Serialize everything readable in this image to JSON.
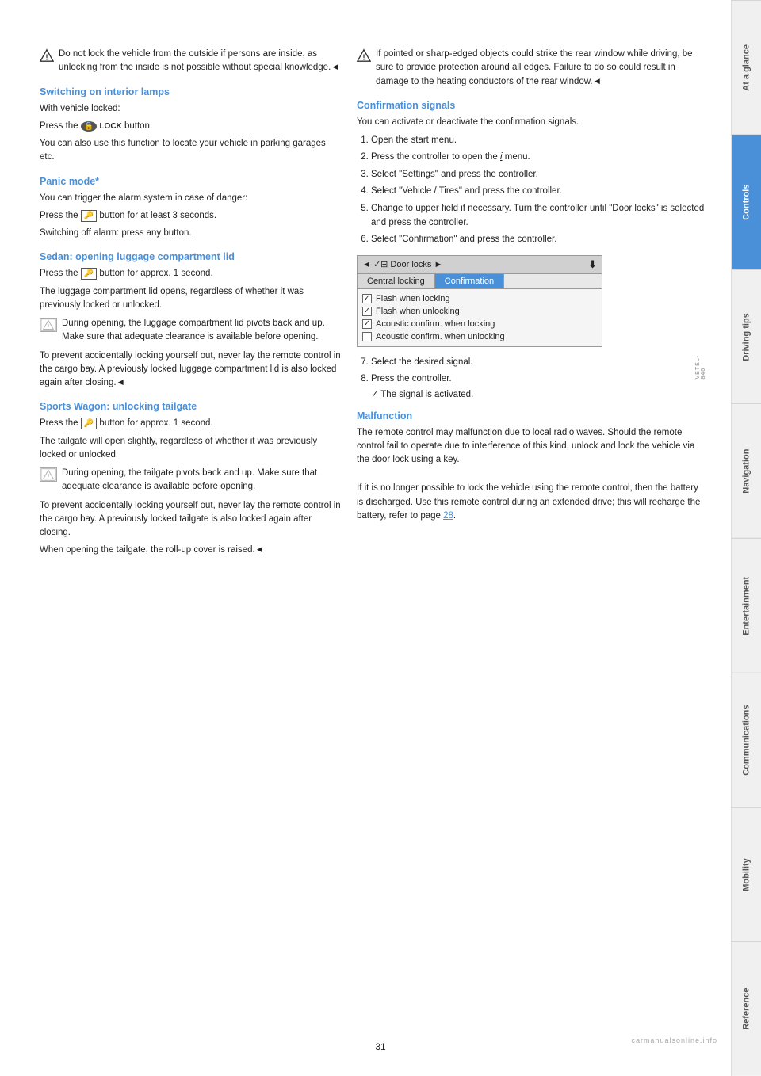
{
  "page": {
    "number": "31"
  },
  "sidebar": {
    "tabs": [
      {
        "label": "At a glance",
        "active": false
      },
      {
        "label": "Controls",
        "active": true
      },
      {
        "label": "Driving tips",
        "active": false
      },
      {
        "label": "Navigation",
        "active": false
      },
      {
        "label": "Entertainment",
        "active": false
      },
      {
        "label": "Communications",
        "active": false
      },
      {
        "label": "Mobility",
        "active": false
      },
      {
        "label": "Reference",
        "active": false
      }
    ]
  },
  "left_col": {
    "warning1": {
      "text": "Do not lock the vehicle from the outside if persons are inside, as unlocking from the inside is not possible without special knowledge.◄"
    },
    "switching_heading": "Switching on interior lamps",
    "switching_text": [
      "With vehicle locked:",
      "Press the 🔒 LOCK button.",
      "You can also use this function to locate your vehicle in parking garages etc."
    ],
    "panic_heading": "Panic mode*",
    "panic_text": [
      "You can trigger the alarm system in case of danger:",
      "Press the 🔑 button for at least 3 seconds.",
      "Switching off alarm: press any button."
    ],
    "sedan_heading": "Sedan: opening luggage compartment lid",
    "sedan_text1": "Press the 🔑 button for approx. 1 second.",
    "sedan_text2": "The luggage compartment lid opens, regardless of whether it was previously locked or unlocked.",
    "sedan_note": "During opening, the luggage compartment lid pivots back and up. Make sure that adequate clearance is available before opening.",
    "sedan_text3": "To prevent accidentally locking yourself out, never lay the remote control in the cargo bay. A previously locked luggage compartment lid is also locked again after closing.◄",
    "sports_heading": "Sports Wagon: unlocking tailgate",
    "sports_text1": "Press the 🔑 button for approx. 1 second.",
    "sports_text2": "The tailgate will open slightly, regardless of whether it was previously locked or unlocked.",
    "sports_note": "During opening, the tailgate pivots back and up. Make sure that adequate clearance is available before opening.",
    "sports_text3": "To prevent accidentally locking yourself out, never lay the remote control in the cargo bay. A previously locked tailgate is also locked again after closing.",
    "sports_text4": "When opening the tailgate, the roll-up cover is raised.◄"
  },
  "right_col": {
    "warning2": {
      "text": "If pointed or sharp-edged objects could strike the rear window while driving, be sure to provide protection around all edges. Failure to do so could result in damage to the heating conductors of the rear window.◄"
    },
    "confirmation_heading": "Confirmation signals",
    "confirmation_intro": "You can activate or deactivate the confirmation signals.",
    "steps": [
      "Open the start menu.",
      "Press the controller to open the i menu.",
      "Select \"Settings\" and press the controller.",
      "Select \"Vehicle / Tires\" and press the controller.",
      "Change to upper field if necessary. Turn the controller until \"Door locks\" is selected and press the controller.",
      "Select \"Confirmation\" and press the controller."
    ],
    "door_locks_ui": {
      "header_left": "◄ ✓⊟ Door locks ►",
      "header_right": "↓",
      "tab1": "Central locking",
      "tab2": "Confirmation",
      "options": [
        {
          "checked": true,
          "label": "Flash when locking"
        },
        {
          "checked": true,
          "label": "Flash when unlocking"
        },
        {
          "checked": true,
          "label": "Acoustic confirm. when locking"
        },
        {
          "checked": false,
          "label": "Acoustic confirm. when unlocking"
        }
      ]
    },
    "steps_after": [
      "Select the desired signal.",
      "Press the controller."
    ],
    "step_result": "The signal is activated.",
    "malfunction_heading": "Malfunction",
    "malfunction_text1": "The remote control may malfunction due to local radio waves. Should the remote control fail to operate due to interference of this kind, unlock and lock the vehicle via the door lock using a key.",
    "malfunction_text2": "If it is no longer possible to lock the vehicle using the remote control, then the battery is discharged. Use this remote control during an extended drive; this will recharge the battery, refer to page 28."
  }
}
